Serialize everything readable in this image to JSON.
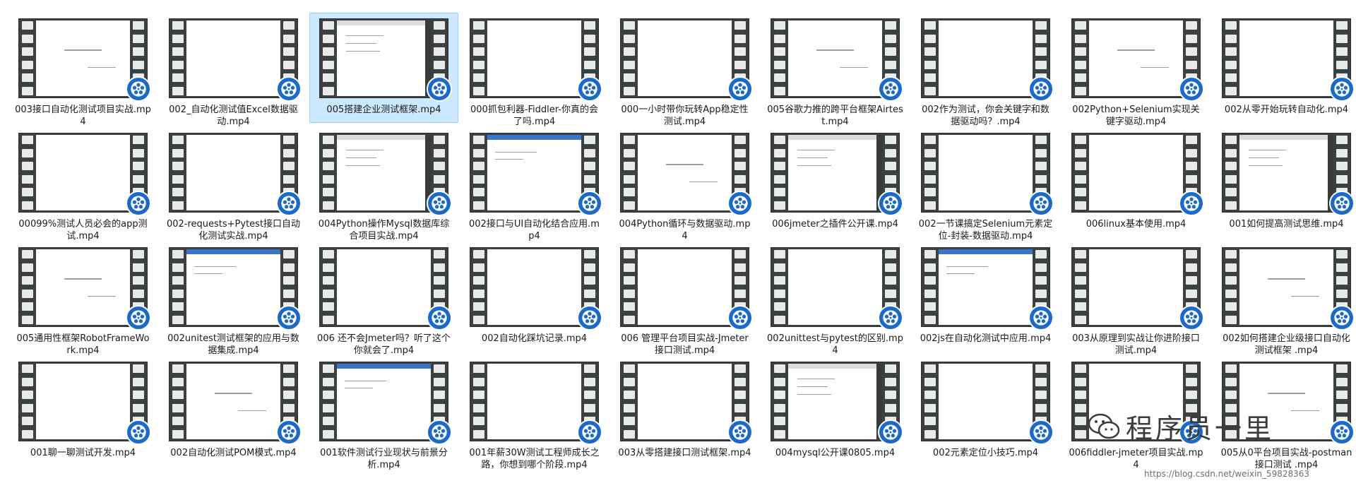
{
  "files": [
    {
      "name": "003接口自动化测试项目实战.mp4",
      "selected": false
    },
    {
      "name": "002_自动化测试值Excel数据驱动.mp4",
      "selected": false
    },
    {
      "name": "005搭建企业测试框架.mp4",
      "selected": true
    },
    {
      "name": "000抓包利器-Fiddler-你真的会了吗.mp4",
      "selected": false
    },
    {
      "name": "000一小时带你玩转App稳定性测试.mp4",
      "selected": false
    },
    {
      "name": "005谷歌力推的跨平台框架Airtest.mp4",
      "selected": false
    },
    {
      "name": "002作为测试，你会关键字和数据驱动吗？.mp4",
      "selected": false
    },
    {
      "name": "002Python+Selenium实现关键字驱动.mp4",
      "selected": false
    },
    {
      "name": "002从零开始玩转自动化.mp4",
      "selected": false
    },
    {
      "name": "00099%测试人员必会的app测试.mp4",
      "selected": false
    },
    {
      "name": "002-requests+Pytest接口自动化测试实战.mp4",
      "selected": false
    },
    {
      "name": "004Python操作Mysql数据库综合项目实战.mp4",
      "selected": false
    },
    {
      "name": "002接口与UI自动化结合应用.mp4",
      "selected": false
    },
    {
      "name": "004Python循环与数据驱动.mp4",
      "selected": false
    },
    {
      "name": "006jmeter之插件公开课.mp4",
      "selected": false
    },
    {
      "name": "002一节课搞定Selenium元素定位-封装-数据驱动.mp4",
      "selected": false
    },
    {
      "name": "006linux基本使用.mp4",
      "selected": false
    },
    {
      "name": "001如何提高测试思维.mp4",
      "selected": false
    },
    {
      "name": "005通用性框架RobotFrameWork.mp4",
      "selected": false
    },
    {
      "name": "002unitest测试框架的应用与数据集成.mp4",
      "selected": false
    },
    {
      "name": "006 还不会Jmeter吗？听了这个你就会了.mp4",
      "selected": false
    },
    {
      "name": "002自动化踩坑记录.mp4",
      "selected": false
    },
    {
      "name": "006 管理平台项目实战-Jmeter接口测试.mp4",
      "selected": false
    },
    {
      "name": "002unittest与pytest的区别.mp4",
      "selected": false
    },
    {
      "name": "002js在自动化测试中应用.mp4",
      "selected": false
    },
    {
      "name": "003从原理到实战让你进阶接口测试.mp4",
      "selected": false
    },
    {
      "name": "002如何搭建企业级接口自动化测试框架 .mp4",
      "selected": false
    },
    {
      "name": "001聊一聊测试开发.mp4",
      "selected": false
    },
    {
      "name": "002自动化测试POM模式.mp4",
      "selected": false
    },
    {
      "name": "001软件测试行业现状与前景分析.mp4",
      "selected": false
    },
    {
      "name": "001年薪30W测试工程师成长之路，你想到哪个阶段.mp4",
      "selected": false
    },
    {
      "name": "003从零搭建接口测试框架.mp4",
      "selected": false
    },
    {
      "name": "004mysql公开课0805.mp4",
      "selected": false
    },
    {
      "name": "002元素定位小技巧.mp4",
      "selected": false
    },
    {
      "name": "006fiddler-jmeter项目实战.mp4",
      "selected": false
    },
    {
      "name": "005从0平台项目实战-postman接口测试 .mp4",
      "selected": false
    }
  ],
  "watermark": {
    "text": "程序员一里",
    "icon": "wechat-icon"
  },
  "csdn_url": "https://blog.csdn.net/weixin_59828363",
  "colors": {
    "selection_bg": "#cce8ff",
    "selection_border": "#99d1ff",
    "badge": "#1b6ac9",
    "film": "#3b4042"
  },
  "file_icon": "qq-video-player-icon"
}
